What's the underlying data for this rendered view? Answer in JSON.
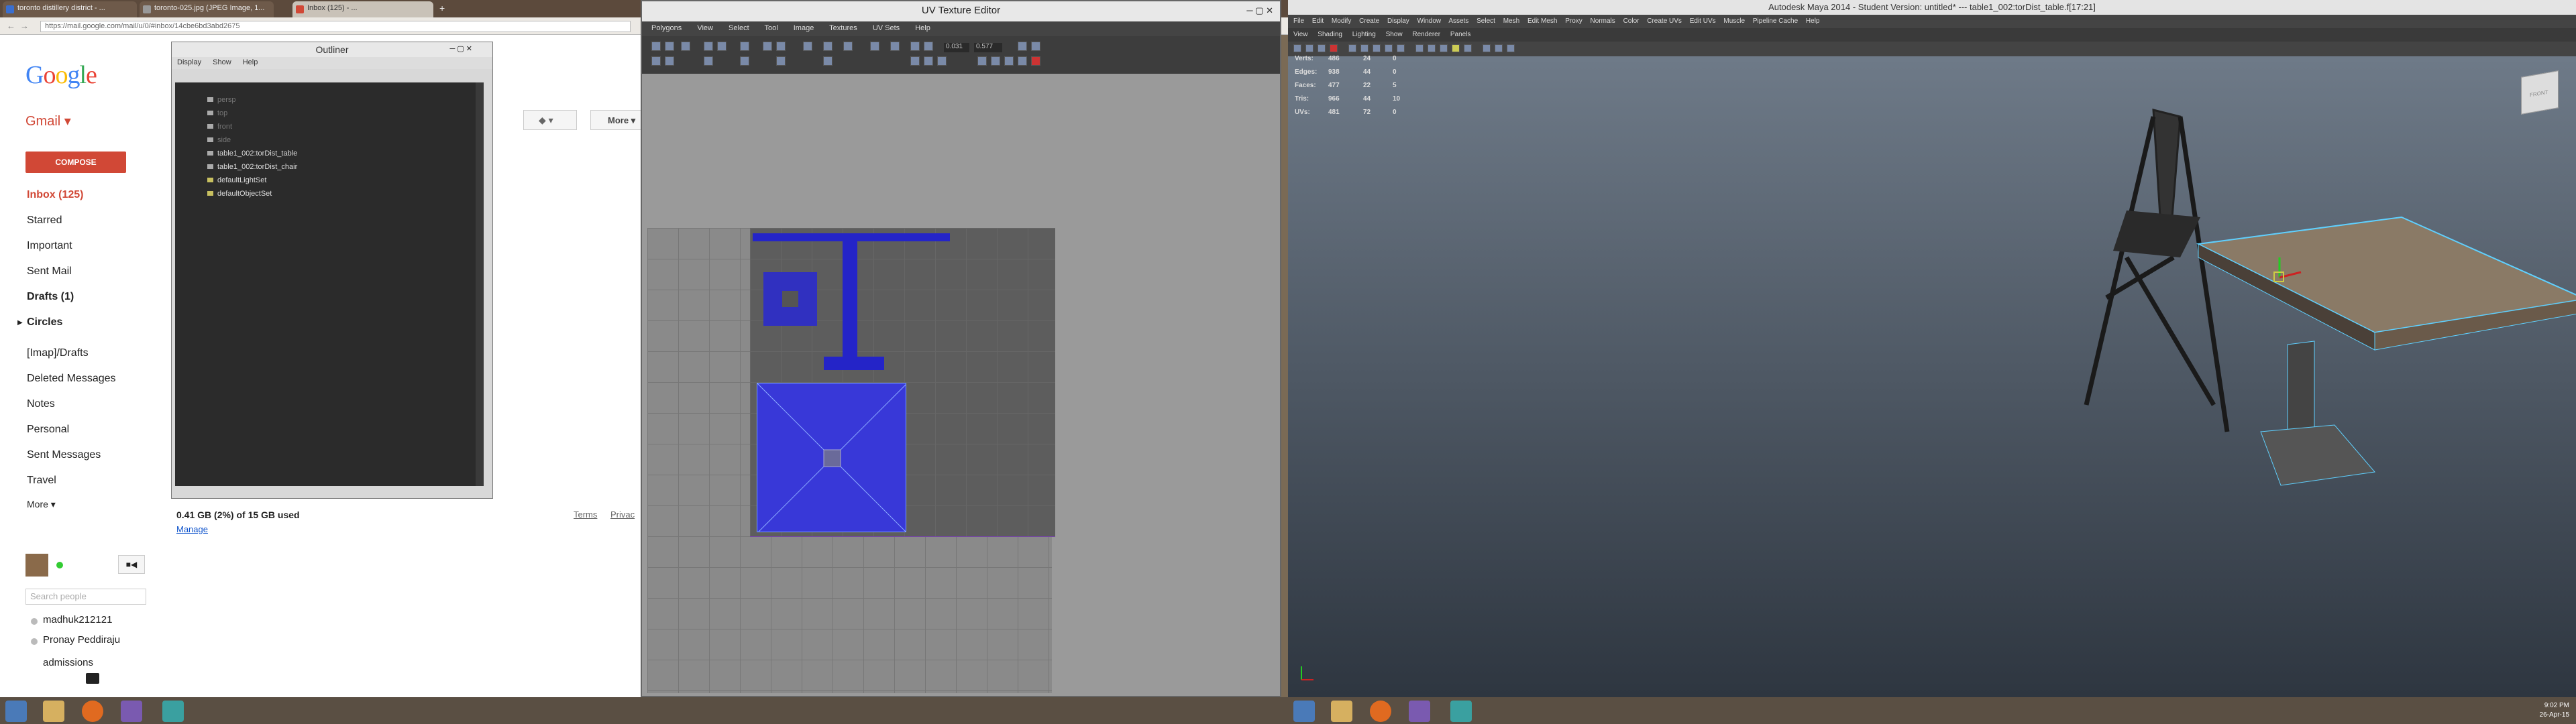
{
  "browser": {
    "tabs": [
      "toronto distillery district - ...",
      "toronto-025.jpg (JPEG Image, 1...",
      "Inbox (125) - ..."
    ],
    "url": "https://mail.google.com/mail/u/0/#inbox/14cbe6bd3abd2675"
  },
  "gmail": {
    "logo": "Google",
    "product": "Gmail",
    "compose": "COMPOSE",
    "more_button": "More",
    "nav": [
      "Inbox (125)",
      "Starred",
      "Important",
      "Sent Mail",
      "Drafts (1)",
      "Circles",
      "[Imap]/Drafts",
      "Deleted Messages",
      "Notes",
      "Personal",
      "Sent Messages",
      "Travel",
      "More"
    ],
    "storage": "0.41 GB (2%) of 15 GB used",
    "manage": "Manage",
    "terms": "Terms",
    "privacy": "Privac",
    "search_people_placeholder": "Search people",
    "contacts": [
      "madhuk212121",
      "Pronay Peddiraju",
      "admissions"
    ]
  },
  "outliner": {
    "title": "Outliner",
    "menu": [
      "Display",
      "Show",
      "Help"
    ],
    "items": [
      "persp",
      "top",
      "front",
      "side",
      "table1_002:torDist_table",
      "table1_002:torDist_chair",
      "defaultLightSet",
      "defaultObjectSet"
    ]
  },
  "uv_editor": {
    "title": "UV Texture Editor",
    "menu": [
      "Polygons",
      "View",
      "Select",
      "Tool",
      "Image",
      "Textures",
      "UV Sets",
      "Help"
    ],
    "field1": "0.031",
    "field2": "0.577"
  },
  "maya": {
    "title": "Autodesk Maya 2014 - Student Version: untitled*  ---  table1_002:torDist_table.f[17:21]",
    "menu": [
      "File",
      "Edit",
      "Modify",
      "Create",
      "Display",
      "Window",
      "Assets",
      "Select",
      "Mesh",
      "Edit Mesh",
      "Proxy",
      "Normals",
      "Color",
      "Create UVs",
      "Edit UVs",
      "Muscle",
      "Pipeline Cache",
      "Help"
    ],
    "panel_menu": [
      "View",
      "Shading",
      "Lighting",
      "Show",
      "Renderer",
      "Panels"
    ],
    "hud": [
      {
        "label": "Verts:",
        "a": "486",
        "b": "24",
        "c": "0"
      },
      {
        "label": "Edges:",
        "a": "938",
        "b": "44",
        "c": "0"
      },
      {
        "label": "Faces:",
        "a": "477",
        "b": "22",
        "c": "5"
      },
      {
        "label": "Tris:",
        "a": "966",
        "b": "44",
        "c": "10"
      },
      {
        "label": "UVs:",
        "a": "481",
        "b": "72",
        "c": "0"
      }
    ],
    "viewcube": "FRONT"
  },
  "taskbar": {
    "time": "9:02 PM",
    "date": "26-Apr-15"
  },
  "colors": {
    "gmail_red": "#d14836",
    "uv_blue": "#2424c8",
    "maya_bg": "#3a4450"
  }
}
